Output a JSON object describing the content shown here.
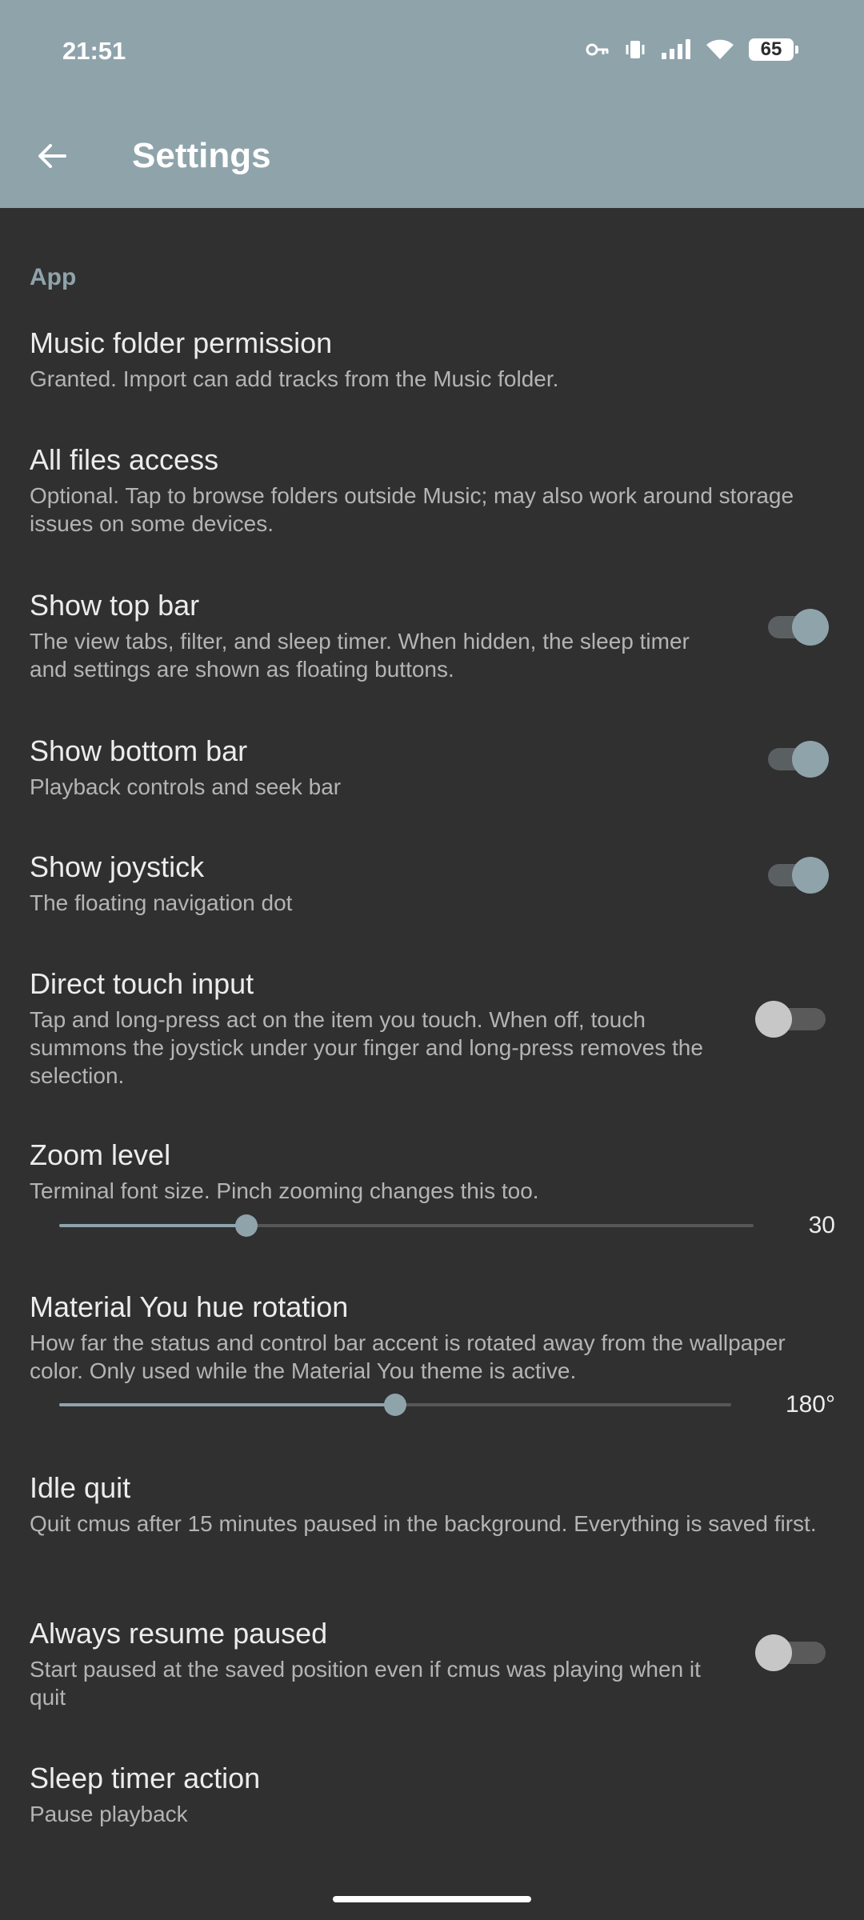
{
  "status_bar": {
    "time": "21:51",
    "battery": "65",
    "icons": [
      "key-icon",
      "vibrate-icon",
      "signal-icon",
      "wifi-icon",
      "battery-icon"
    ]
  },
  "header": {
    "back_icon": "arrow-left-icon",
    "title": "Settings"
  },
  "section": {
    "label": "App"
  },
  "items": [
    {
      "title": "Music folder permission",
      "description": "Granted. Import can add tracks from the Music folder."
    },
    {
      "title": "All files access",
      "description": "Optional. Tap to browse folders outside Music; may also work around storage issues on some devices."
    },
    {
      "title": "Show top bar",
      "description": "The view tabs, filter, and sleep timer. When hidden, the sleep timer and settings are shown as floating buttons.",
      "toggle": true
    },
    {
      "title": "Show bottom bar",
      "description": "Playback controls and seek bar",
      "toggle": true
    },
    {
      "title": "Show joystick",
      "description": "The floating navigation dot",
      "toggle": true
    },
    {
      "title": "Direct touch input",
      "description": "Tap and long-press act on the item you touch. When off, touch summons the joystick under your finger and long-press removes the selection.",
      "toggle": false
    },
    {
      "title": "Zoom level",
      "description": "Terminal font size. Pinch zooming changes this too.",
      "slider_value": "30",
      "slider_fraction": 0.27
    },
    {
      "title": "Material You hue rotation",
      "description": "How far the status and control bar accent is rotated away from the wallpaper color. Only used while the Material You theme is active.",
      "slider_value": "180°",
      "slider_fraction": 0.5
    },
    {
      "title": "Idle quit",
      "description": "Quit cmus after 15 minutes paused in the background. Everything is saved first."
    },
    {
      "title": "Always resume paused",
      "description": "Start paused at the saved position even if cmus was playing when it quit",
      "toggle": false
    },
    {
      "title": "Sleep timer action",
      "description": "Pause playback"
    }
  ],
  "colors": {
    "accent": "#8fa3ab",
    "background": "#303030"
  }
}
